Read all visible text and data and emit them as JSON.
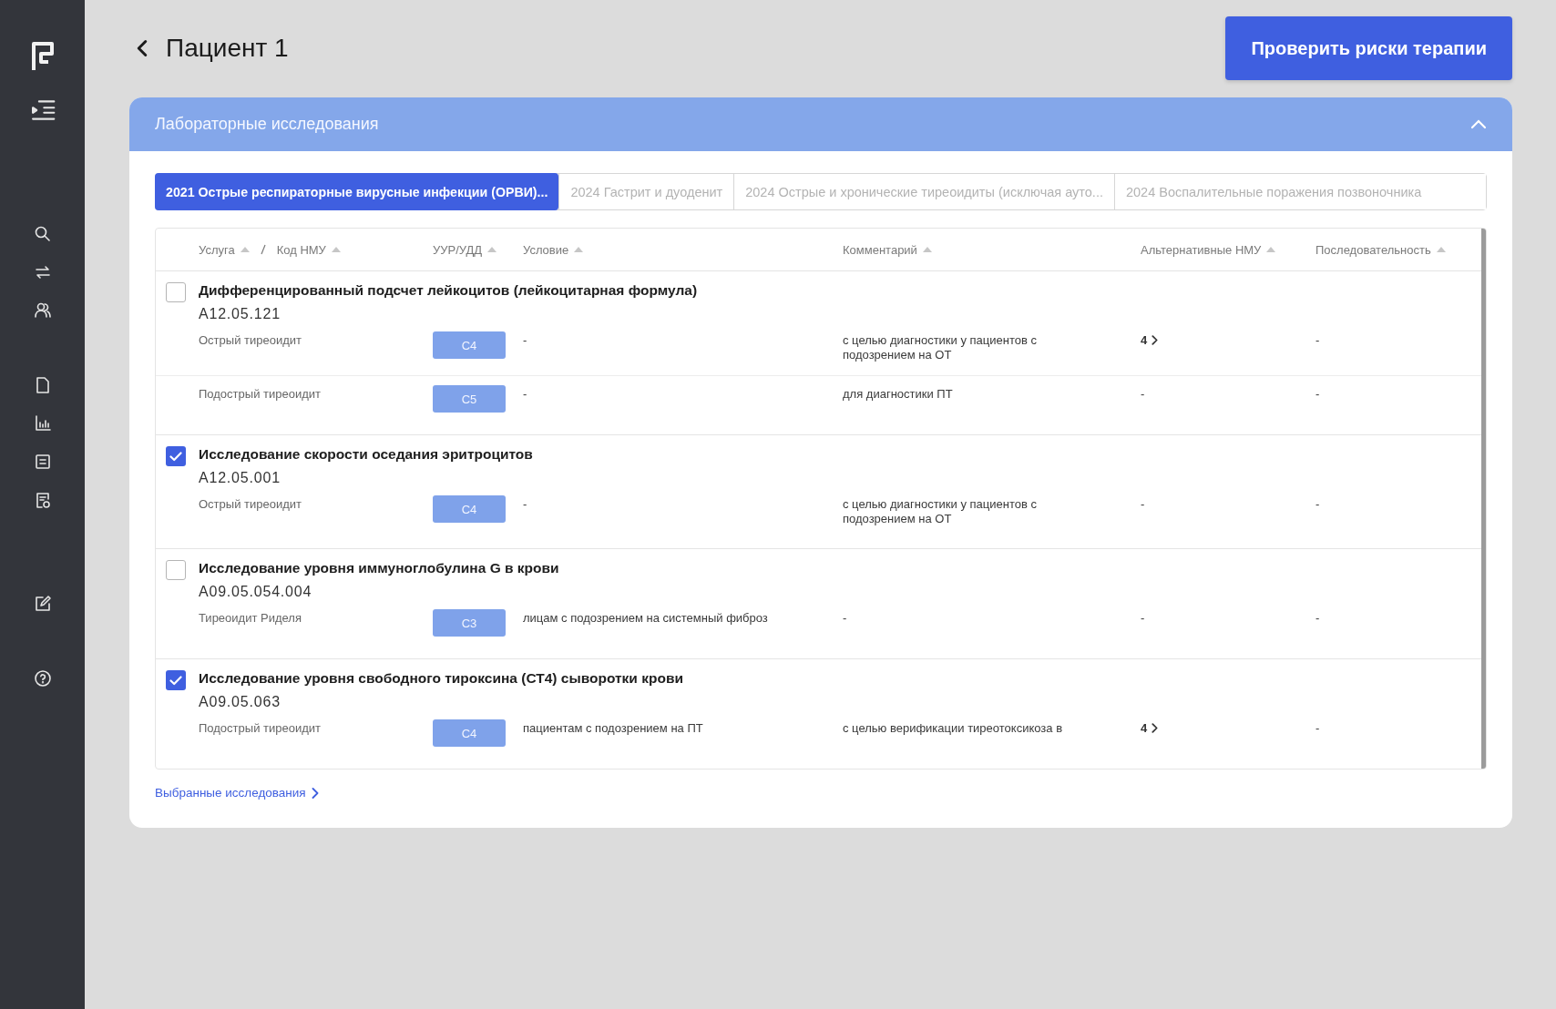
{
  "header": {
    "title": "Пациент 1",
    "action_button": "Проверить риски терапии"
  },
  "section": {
    "title": "Лабораторные исследования",
    "expanded": true,
    "tabs": [
      {
        "label": "2021 Острые респираторные вирусные инфекции (ОРВИ)...",
        "selected": true
      },
      {
        "label": "2024 Гастрит и дуоденит",
        "selected": false
      },
      {
        "label": "2024 Острые и хронические тиреоидиты (исключая ауто...",
        "selected": false
      },
      {
        "label": "2024 Воспалительные поражения позвоночника",
        "selected": false
      }
    ],
    "columns": [
      "Услуга",
      "Код НМУ",
      "УУР/УДД",
      "Условие",
      "Комментарий",
      "Альтернативные НМУ",
      "Последовательность"
    ],
    "rows": [
      {
        "name": "Дифференцированный подсчет лейкоцитов (лейкоцитарная формула)",
        "code": "A12.05.121",
        "checked": false,
        "conditions": [
          {
            "diagnosis": "Острый тиреоидит",
            "grade": "С4",
            "condition": "-",
            "comment": "с целью диагностики у пациентов с подозрением на ОТ",
            "alternatives": {
              "text": "4",
              "link": true
            },
            "sequence": "-"
          },
          {
            "diagnosis": "Подострый тиреоидит",
            "grade": "С5",
            "condition": "-",
            "comment": "для диагностики ПТ",
            "alternatives": {
              "text": "-",
              "link": false
            },
            "sequence": "-"
          }
        ]
      },
      {
        "name": "Исследование скорости оседания эритроцитов",
        "code": "A12.05.001",
        "checked": true,
        "conditions": [
          {
            "diagnosis": "Острый тиреоидит",
            "grade": "С4",
            "condition": "-",
            "comment": "с целью диагностики у пациентов с подозрением на ОТ",
            "alternatives": {
              "text": "-",
              "link": false
            },
            "sequence": "-"
          }
        ]
      },
      {
        "name": "Исследование уровня иммуноглобулина G в крови",
        "code": "A09.05.054.004",
        "checked": false,
        "conditions": [
          {
            "diagnosis": "Тиреоидит Риделя",
            "grade": "С3",
            "condition": "лицам с подозрением на системный фиброз",
            "comment": "-",
            "alternatives": {
              "text": "-",
              "link": false
            },
            "sequence": "-"
          }
        ]
      },
      {
        "name": "Исследование уровня свободного тироксина (СТ4) сыворотки крови",
        "code": "A09.05.063",
        "checked": true,
        "conditions": [
          {
            "diagnosis": "Подострый тиреоидит",
            "grade": "С4",
            "condition": "пациентам с подозрением на ПТ",
            "comment": "с целью верификации тиреотоксикоза в",
            "alternatives": {
              "text": "4",
              "link": true
            },
            "sequence": "-"
          }
        ]
      }
    ],
    "footer_link": "Выбранные исследования"
  }
}
